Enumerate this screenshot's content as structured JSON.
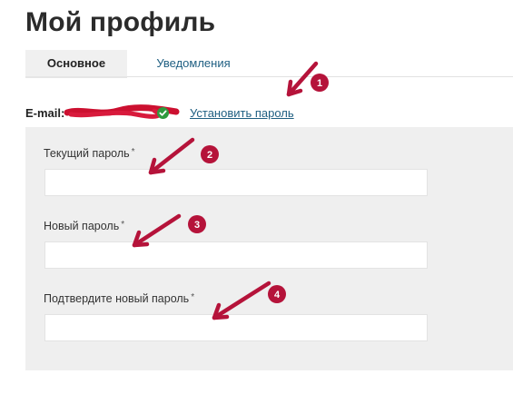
{
  "page": {
    "title": "Мой профиль"
  },
  "tabs": [
    {
      "label": "Основное",
      "active": true
    },
    {
      "label": "Уведомления",
      "active": false
    }
  ],
  "email": {
    "label": "E-mail:",
    "verified_icon": "check-circle-icon",
    "set_password_link": "Установить пароль"
  },
  "form": {
    "fields": [
      {
        "label": "Текущий пароль",
        "required_mark": "*",
        "value": ""
      },
      {
        "label": "Новый пароль",
        "required_mark": "*",
        "value": ""
      },
      {
        "label": "Подтвердите новый пароль",
        "required_mark": "*",
        "value": ""
      }
    ]
  },
  "annotations": {
    "badges": [
      "1",
      "2",
      "3",
      "4"
    ]
  },
  "colors": {
    "link": "#1f5f82",
    "annotation": "#b5133a",
    "verified": "#2e9a3e",
    "panel": "#efefef"
  }
}
